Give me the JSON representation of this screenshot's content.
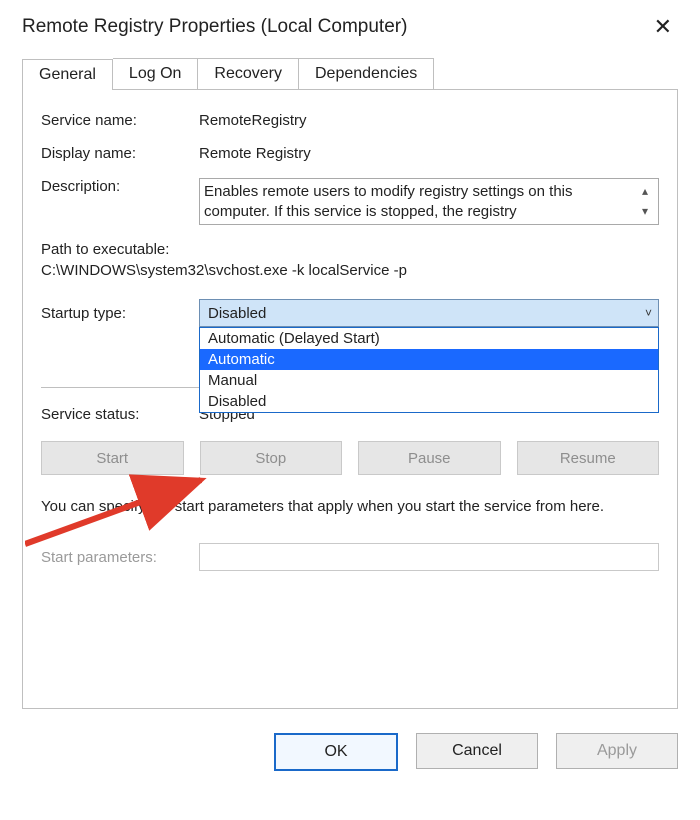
{
  "window_title": "Remote Registry Properties (Local Computer)",
  "tabs": [
    "General",
    "Log On",
    "Recovery",
    "Dependencies"
  ],
  "active_tab": 0,
  "general": {
    "labels": {
      "service_name": "Service name:",
      "display_name": "Display name:",
      "description": "Description:",
      "path": "Path to executable:",
      "startup_type": "Startup type:",
      "service_status": "Service status:",
      "start_parameters": "Start parameters:"
    },
    "service_name": "RemoteRegistry",
    "display_name": "Remote Registry",
    "description": "Enables remote users to modify registry settings on this computer. If this service is stopped, the registry",
    "path_value": "C:\\WINDOWS\\system32\\svchost.exe -k localService -p",
    "startup_type_value": "Disabled",
    "startup_options": [
      "Automatic (Delayed Start)",
      "Automatic",
      "Manual",
      "Disabled"
    ],
    "startup_selected_index": 1,
    "service_status_value": "Stopped",
    "action_buttons": {
      "start": "Start",
      "stop": "Stop",
      "pause": "Pause",
      "resume": "Resume"
    },
    "note": "You can specify the start parameters that apply when you start the service from here.",
    "start_parameters_value": ""
  },
  "dialog_buttons": {
    "ok": "OK",
    "cancel": "Cancel",
    "apply": "Apply"
  },
  "icons": {
    "close": "✕",
    "chevron_down": "˅",
    "scroll_up": "▴",
    "scroll_down": "▾"
  }
}
